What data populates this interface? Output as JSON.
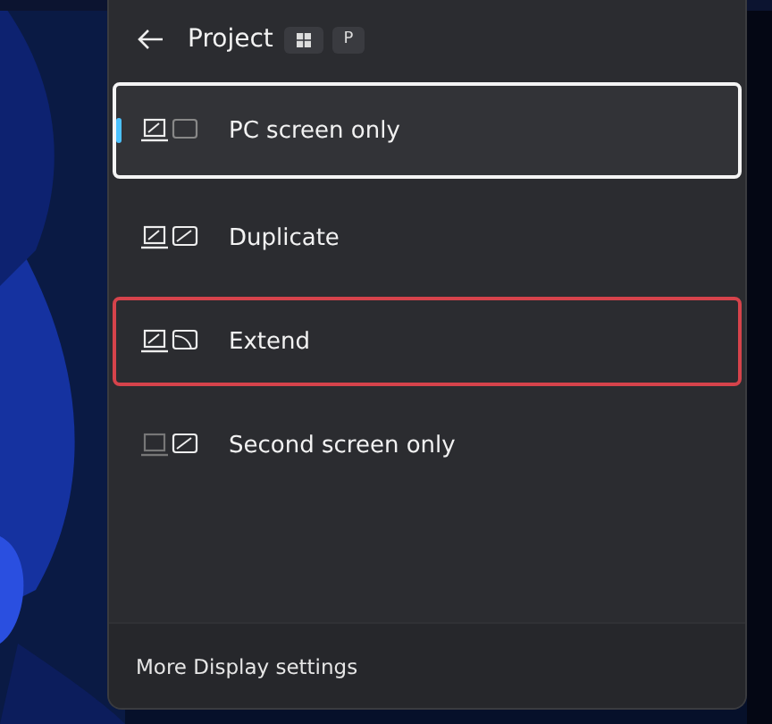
{
  "header": {
    "title": "Project",
    "shortcut_key": "P"
  },
  "options": [
    {
      "kind": "pc-only",
      "label": "PC screen only",
      "selected": true,
      "highlighted": false
    },
    {
      "kind": "duplicate",
      "label": "Duplicate",
      "selected": false,
      "highlighted": false
    },
    {
      "kind": "extend",
      "label": "Extend",
      "selected": false,
      "highlighted": true
    },
    {
      "kind": "second-only",
      "label": "Second screen only",
      "selected": false,
      "highlighted": false
    }
  ],
  "footer": {
    "link": "More Display settings"
  }
}
